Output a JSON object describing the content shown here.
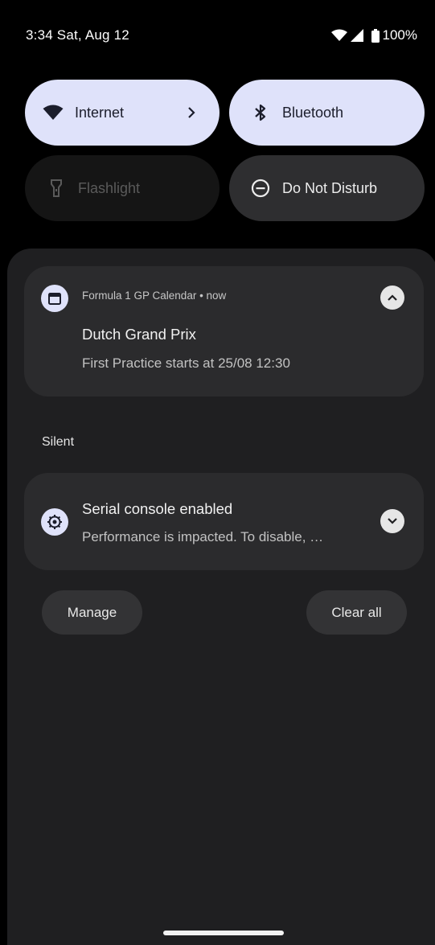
{
  "status_bar": {
    "time": "3:34 Sat, Aug 12",
    "battery": "100%",
    "icons": [
      "wifi-icon",
      "cell-signal-icon",
      "battery-icon"
    ]
  },
  "quick_settings": {
    "tiles": [
      {
        "label": "Internet",
        "icon": "wifi-icon",
        "active": true
      },
      {
        "label": "Bluetooth",
        "icon": "bluetooth-icon",
        "active": true
      },
      {
        "label": "Flashlight",
        "icon": "flashlight-icon",
        "active": false
      },
      {
        "label": "Do Not Disturb",
        "icon": "dnd-icon",
        "active": false
      }
    ]
  },
  "notifications": {
    "f1": {
      "app_line": "Formula 1 GP Calendar • now",
      "title": "Dutch Grand Prix",
      "text": "First Practice starts at 25/08 12:30",
      "icon": "calendar-icon"
    },
    "silent_label": "Silent",
    "serial": {
      "title": "Serial console enabled",
      "text": "Performance is impacted. To disable, …",
      "icon": "gear-icon"
    }
  },
  "actions": {
    "manage": "Manage",
    "clear_all": "Clear all"
  },
  "colors": {
    "tile_active": "#dfe2fa",
    "shade_background": "#1f1f21",
    "card_background": "#2b2b2d"
  }
}
